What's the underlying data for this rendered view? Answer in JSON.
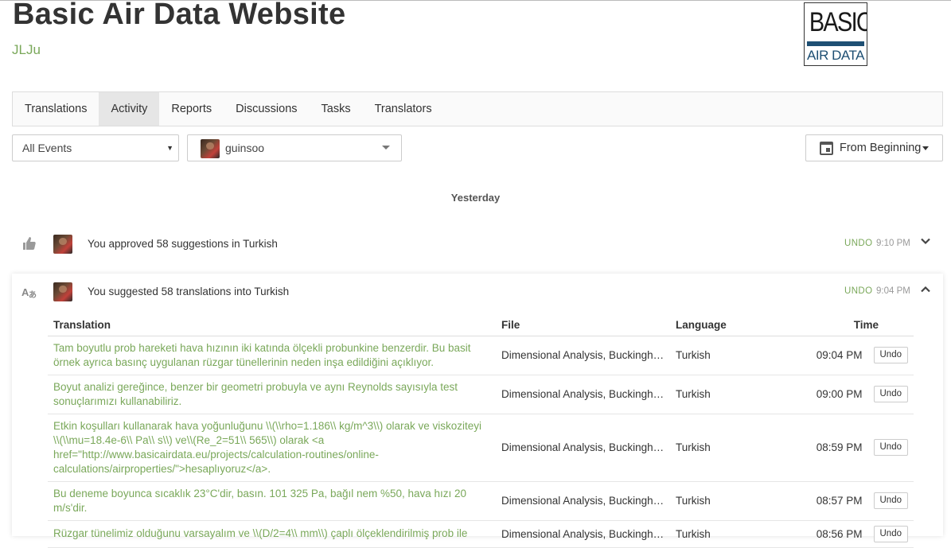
{
  "project": {
    "title": "Basic Air Data Website",
    "organization": "JLJu"
  },
  "logo": {
    "line1": "BASIC",
    "line2": "AIR DATA"
  },
  "tabs": [
    {
      "label": "Translations",
      "active": false
    },
    {
      "label": "Activity",
      "active": true
    },
    {
      "label": "Reports",
      "active": false
    },
    {
      "label": "Discussions",
      "active": false
    },
    {
      "label": "Tasks",
      "active": false
    },
    {
      "label": "Translators",
      "active": false
    }
  ],
  "filters": {
    "events": "All Events",
    "user": "guinsoo",
    "date": "From Beginning"
  },
  "day_label": "Yesterday",
  "events": [
    {
      "icon": "thumbs-up-icon",
      "text": "You approved 58 suggestions in Turkish",
      "undo": "UNDO",
      "time": "9:10 PM",
      "expanded": false
    },
    {
      "icon": "translate-icon",
      "text": "You suggested 58 translations into Turkish",
      "undo": "UNDO",
      "time": "9:04 PM",
      "expanded": true
    }
  ],
  "table": {
    "headers": {
      "translation": "Translation",
      "file": "File",
      "language": "Language",
      "time": "Time"
    },
    "rows": [
      {
        "translation": "Tam boyutlu prob hareketi hava hızının iki katında ölçekli probunkine benzerdir. Bu basit örnek ayrıca basınç uygulanan rüzgar tünellerinin neden inşa edildiğini açıklıyor.",
        "file": "Dimensional Analysis, Buckingham Pi Theorem",
        "language": "Turkish",
        "time": "09:04 PM",
        "undo": "Undo"
      },
      {
        "translation": "Boyut analizi gereğince, benzer bir geometri probuyla ve aynı Reynolds sayısıyla test sonuçlarımızı kullanabiliriz.",
        "file": "Dimensional Analysis, Buckingham Pi Theorem",
        "language": "Turkish",
        "time": "09:00 PM",
        "undo": "Undo"
      },
      {
        "translation": "Etkin koşulları kullanarak hava yoğunluğunu \\\\(\\\\rho=1.186\\\\ kg/m^3\\\\) olarak ve viskoziteyi \\\\(\\\\mu=18.4e-6\\\\ Pa\\\\ s\\\\) ve\\\\(Re_2=51\\\\ 565\\\\) olarak <a href=\"http://www.basicairdata.eu/projects/calculation-routines/online-calculations/airproperties/\">hesaplıyoruz</a>.",
        "file": "Dimensional Analysis, Buckingham Pi Theorem",
        "language": "Turkish",
        "time": "08:59 PM",
        "undo": "Undo"
      },
      {
        "translation": "Bu deneme boyunca sıcaklık 23°C'dir, basın. 101 325 Pa, bağıl nem %50, hava hızı 20 m/s'dir.",
        "file": "Dimensional Analysis, Buckingham Pi Theorem",
        "language": "Turkish",
        "time": "08:57 PM",
        "undo": "Undo"
      },
      {
        "translation": "Rüzgar tünelimiz olduğunu varsayalım ve \\\\(D/2=4\\\\ mm\\\\) çaplı ölçeklendirilmiş prob ile",
        "file": "Dimensional Analysis, Buckingham Pi Theorem",
        "language": "Turkish",
        "time": "08:56 PM",
        "undo": "Undo"
      }
    ]
  }
}
